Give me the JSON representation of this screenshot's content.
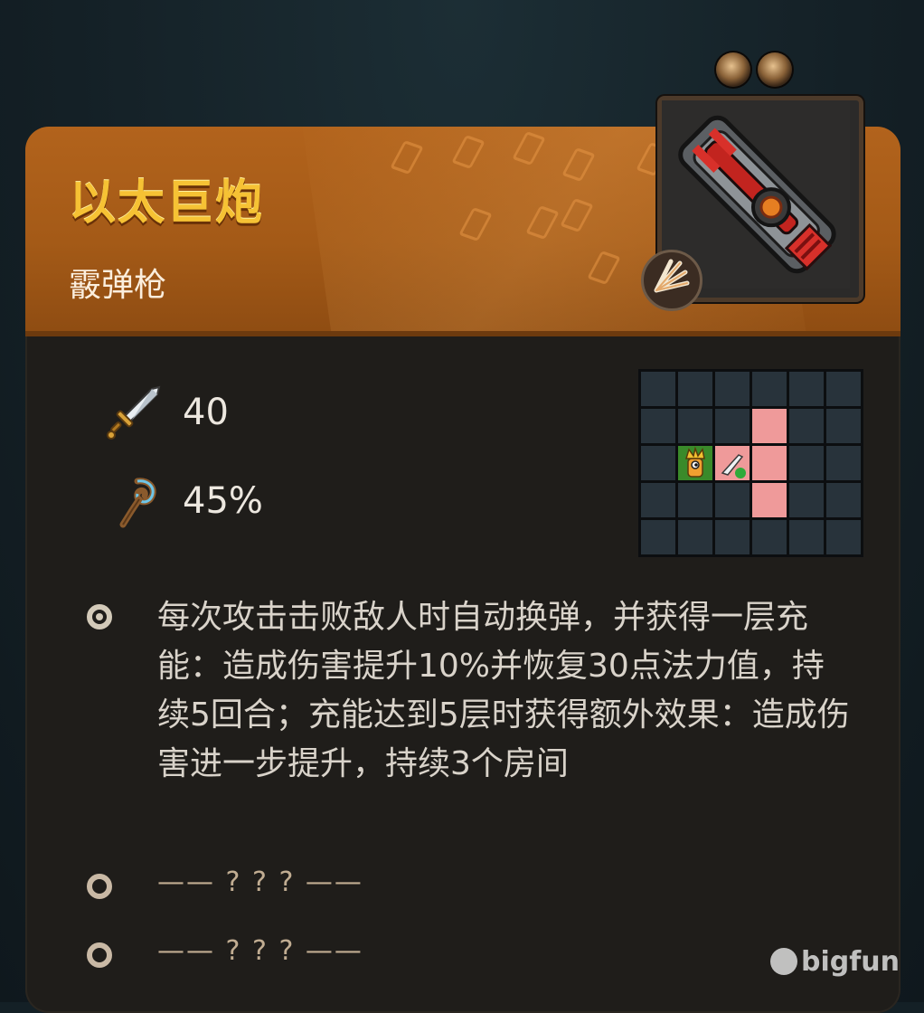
{
  "item": {
    "name": "以太巨炮",
    "type": "霰弹枪"
  },
  "stats": {
    "attack": "40",
    "crit": "45%"
  },
  "effects": {
    "main": "每次攻击击败敌人时自动换弹，并获得一层充能：造成伤害提升10%并恢复30点法力值，持续5回合；充能达到5层时获得额外效果：造成伤害进一步提升，持续3个房间",
    "locked_1": "—— ? ? ? ——",
    "locked_2": "—— ? ? ? ——"
  },
  "range_grid": {
    "cols": 6,
    "rows": 5,
    "cells": [
      [
        "empty",
        "empty",
        "empty",
        "empty",
        "empty",
        "empty"
      ],
      [
        "empty",
        "empty",
        "empty",
        "hit",
        "empty",
        "empty"
      ],
      [
        "empty",
        "player",
        "weapon",
        "hit",
        "empty",
        "empty"
      ],
      [
        "empty",
        "empty",
        "empty",
        "hit",
        "empty",
        "empty"
      ],
      [
        "empty",
        "empty",
        "empty",
        "empty",
        "empty",
        "empty"
      ]
    ]
  },
  "watermark": "bigfun",
  "icons": {
    "attack": "sword-icon",
    "crit": "staff-icon",
    "upgrade_slots": "gem-slot-icon",
    "weapon_type": "burst-icon"
  },
  "colors": {
    "header": "#b2631c",
    "title": "#f6c234",
    "hit_cell": "#ef9a9a",
    "grid_cell": "#28333b"
  }
}
